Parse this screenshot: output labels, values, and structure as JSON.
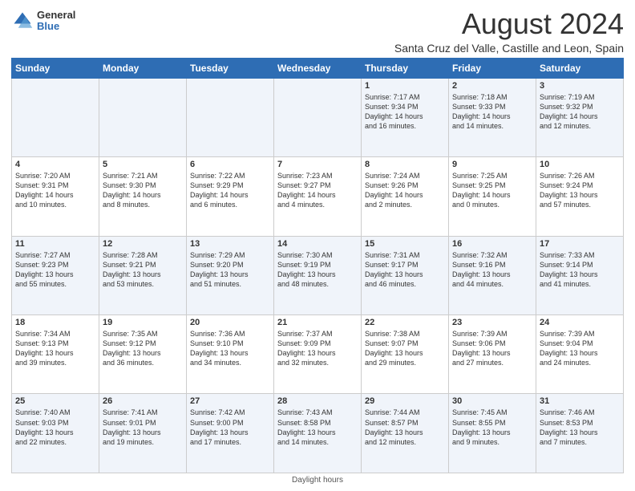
{
  "logo": {
    "general": "General",
    "blue": "Blue"
  },
  "title": "August 2024",
  "subtitle": "Santa Cruz del Valle, Castille and Leon, Spain",
  "days_header": [
    "Sunday",
    "Monday",
    "Tuesday",
    "Wednesday",
    "Thursday",
    "Friday",
    "Saturday"
  ],
  "footer": "Daylight hours",
  "weeks": [
    [
      {
        "num": "",
        "info": ""
      },
      {
        "num": "",
        "info": ""
      },
      {
        "num": "",
        "info": ""
      },
      {
        "num": "",
        "info": ""
      },
      {
        "num": "1",
        "info": "Sunrise: 7:17 AM\nSunset: 9:34 PM\nDaylight: 14 hours\nand 16 minutes."
      },
      {
        "num": "2",
        "info": "Sunrise: 7:18 AM\nSunset: 9:33 PM\nDaylight: 14 hours\nand 14 minutes."
      },
      {
        "num": "3",
        "info": "Sunrise: 7:19 AM\nSunset: 9:32 PM\nDaylight: 14 hours\nand 12 minutes."
      }
    ],
    [
      {
        "num": "4",
        "info": "Sunrise: 7:20 AM\nSunset: 9:31 PM\nDaylight: 14 hours\nand 10 minutes."
      },
      {
        "num": "5",
        "info": "Sunrise: 7:21 AM\nSunset: 9:30 PM\nDaylight: 14 hours\nand 8 minutes."
      },
      {
        "num": "6",
        "info": "Sunrise: 7:22 AM\nSunset: 9:29 PM\nDaylight: 14 hours\nand 6 minutes."
      },
      {
        "num": "7",
        "info": "Sunrise: 7:23 AM\nSunset: 9:27 PM\nDaylight: 14 hours\nand 4 minutes."
      },
      {
        "num": "8",
        "info": "Sunrise: 7:24 AM\nSunset: 9:26 PM\nDaylight: 14 hours\nand 2 minutes."
      },
      {
        "num": "9",
        "info": "Sunrise: 7:25 AM\nSunset: 9:25 PM\nDaylight: 14 hours\nand 0 minutes."
      },
      {
        "num": "10",
        "info": "Sunrise: 7:26 AM\nSunset: 9:24 PM\nDaylight: 13 hours\nand 57 minutes."
      }
    ],
    [
      {
        "num": "11",
        "info": "Sunrise: 7:27 AM\nSunset: 9:23 PM\nDaylight: 13 hours\nand 55 minutes."
      },
      {
        "num": "12",
        "info": "Sunrise: 7:28 AM\nSunset: 9:21 PM\nDaylight: 13 hours\nand 53 minutes."
      },
      {
        "num": "13",
        "info": "Sunrise: 7:29 AM\nSunset: 9:20 PM\nDaylight: 13 hours\nand 51 minutes."
      },
      {
        "num": "14",
        "info": "Sunrise: 7:30 AM\nSunset: 9:19 PM\nDaylight: 13 hours\nand 48 minutes."
      },
      {
        "num": "15",
        "info": "Sunrise: 7:31 AM\nSunset: 9:17 PM\nDaylight: 13 hours\nand 46 minutes."
      },
      {
        "num": "16",
        "info": "Sunrise: 7:32 AM\nSunset: 9:16 PM\nDaylight: 13 hours\nand 44 minutes."
      },
      {
        "num": "17",
        "info": "Sunrise: 7:33 AM\nSunset: 9:14 PM\nDaylight: 13 hours\nand 41 minutes."
      }
    ],
    [
      {
        "num": "18",
        "info": "Sunrise: 7:34 AM\nSunset: 9:13 PM\nDaylight: 13 hours\nand 39 minutes."
      },
      {
        "num": "19",
        "info": "Sunrise: 7:35 AM\nSunset: 9:12 PM\nDaylight: 13 hours\nand 36 minutes."
      },
      {
        "num": "20",
        "info": "Sunrise: 7:36 AM\nSunset: 9:10 PM\nDaylight: 13 hours\nand 34 minutes."
      },
      {
        "num": "21",
        "info": "Sunrise: 7:37 AM\nSunset: 9:09 PM\nDaylight: 13 hours\nand 32 minutes."
      },
      {
        "num": "22",
        "info": "Sunrise: 7:38 AM\nSunset: 9:07 PM\nDaylight: 13 hours\nand 29 minutes."
      },
      {
        "num": "23",
        "info": "Sunrise: 7:39 AM\nSunset: 9:06 PM\nDaylight: 13 hours\nand 27 minutes."
      },
      {
        "num": "24",
        "info": "Sunrise: 7:39 AM\nSunset: 9:04 PM\nDaylight: 13 hours\nand 24 minutes."
      }
    ],
    [
      {
        "num": "25",
        "info": "Sunrise: 7:40 AM\nSunset: 9:03 PM\nDaylight: 13 hours\nand 22 minutes."
      },
      {
        "num": "26",
        "info": "Sunrise: 7:41 AM\nSunset: 9:01 PM\nDaylight: 13 hours\nand 19 minutes."
      },
      {
        "num": "27",
        "info": "Sunrise: 7:42 AM\nSunset: 9:00 PM\nDaylight: 13 hours\nand 17 minutes."
      },
      {
        "num": "28",
        "info": "Sunrise: 7:43 AM\nSunset: 8:58 PM\nDaylight: 13 hours\nand 14 minutes."
      },
      {
        "num": "29",
        "info": "Sunrise: 7:44 AM\nSunset: 8:57 PM\nDaylight: 13 hours\nand 12 minutes."
      },
      {
        "num": "30",
        "info": "Sunrise: 7:45 AM\nSunset: 8:55 PM\nDaylight: 13 hours\nand 9 minutes."
      },
      {
        "num": "31",
        "info": "Sunrise: 7:46 AM\nSunset: 8:53 PM\nDaylight: 13 hours\nand 7 minutes."
      }
    ]
  ]
}
